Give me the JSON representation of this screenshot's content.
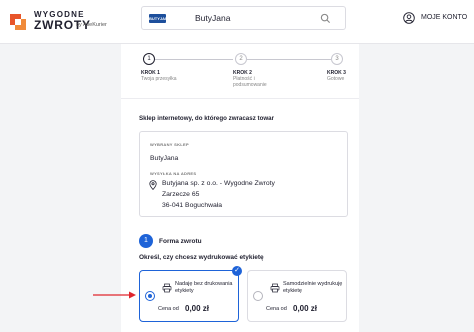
{
  "header": {
    "logo_line1": "WYGODNE",
    "logo_line2": "ZWROTY",
    "logo_byline": "by AlleKurier",
    "search_brand": "BUTYJANA",
    "search_value": "ButyJana",
    "account_label": "MOJE KONTO"
  },
  "stepper": [
    {
      "num": "1",
      "title": "KROK 1",
      "sub": "Twoja przesyłka"
    },
    {
      "num": "2",
      "title": "KROK 2",
      "sub": "Płatność i podsumowanie"
    },
    {
      "num": "3",
      "title": "KROK 3",
      "sub": "Gotowe"
    }
  ],
  "shop": {
    "section_title": "Sklep internetowy, do którego zwracasz towar",
    "selected_label": "WYBRANY SKLEP",
    "name": "ButyJana",
    "ship_label": "WYSYŁKA NA ADRES",
    "address_lines": [
      "Butyjana sp. z o.o. - Wygodne Zwroty",
      "Zarzecze 65",
      "36-041 Boguchwała"
    ]
  },
  "form": {
    "num": "1",
    "title": "Forma zwrotu",
    "question": "Określ, czy chcesz wydrukować etykietę",
    "options": [
      {
        "label": "Nadaję bez drukowania etykiety",
        "price_label": "Cena od",
        "price": "0,00 zł",
        "selected": true
      },
      {
        "label": "Samodzielnie wydrukuję etykietę",
        "price_label": "Cena od",
        "price": "0,00 zł",
        "selected": false
      }
    ]
  },
  "colors": {
    "accent": "#1e63d8",
    "arrow": "#e0262d",
    "logo": "#e8552a"
  }
}
